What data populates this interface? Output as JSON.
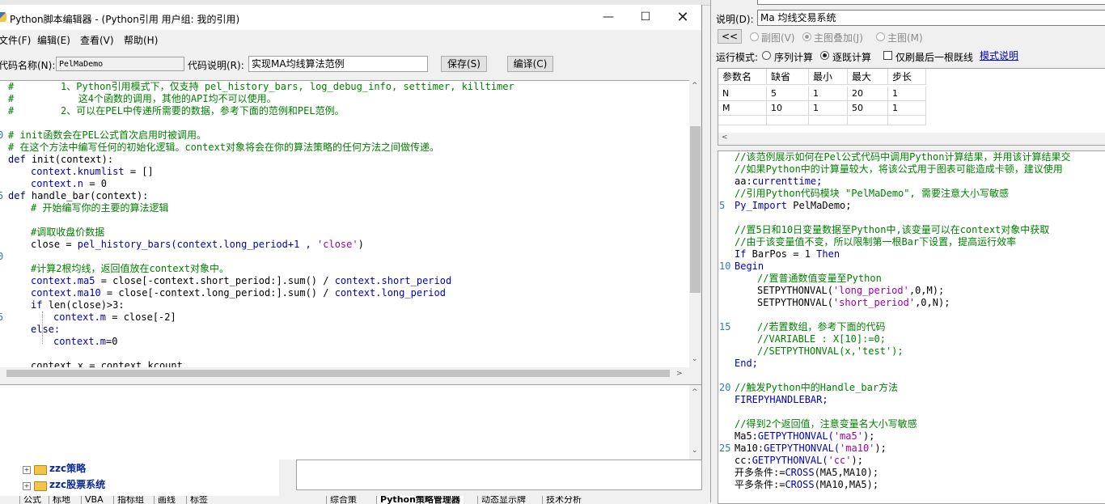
{
  "editor": {
    "title": "Python脚本编辑器 - (Python引用 用户组: 我的引用)",
    "menu": [
      "文件(F)",
      "编辑(E)",
      "查看(V)",
      "帮助(H)"
    ],
    "code_name_label": "代码名称(N):",
    "code_name_value": "PelMaDemo",
    "code_desc_label": "代码说明(R):",
    "code_desc_value": "实现MA均线算法范例",
    "save_label": "保存(S)",
    "compile_label": "编译(C)",
    "line_numbers": {
      "l5": "0",
      "l10": "5",
      "l15": "0",
      "l20": "5"
    },
    "code": {
      "c0": "#        1、Python引用模式下，仅支持 pel_history_bars, log_debug_info, settimer, killtimer",
      "c1": "#           这4个函数的调用，其他的API均不可以使用。",
      "c2": "#        2、可以在PEL中传递所需要的数据，参考下面的范例和PEL范例。",
      "c4a": "# init函数会在PEL公式首次启用时被调用。",
      "c5": "# 在这个方法中编写任何的初始化逻辑。context对象将会在你的算法策略的任何方法之间做传递。",
      "c6a": "def ",
      "c6b": "init(context):",
      "c7a": "context.knumlist",
      "c7b": " = []",
      "c8a": "context.n",
      "c8b": " = 0",
      "c9a": "def ",
      "c9b": "handle_bar(context):",
      "c10": "# 开始编写你的主要的算法逻辑",
      "c12": "#调取收盘价数据",
      "c13a": "close = ",
      "c13b": "pel_history_bars(context.long_period+1 , ",
      "c13c": "'close'",
      "c13d": ")",
      "c15": "#计算2根均线，返回值放在context对象中。",
      "c16a": "context.ma5",
      "c16b": " = close[-context.short_period:].sum() / ",
      "c16c": "context.short_period",
      "c17a": "context.ma10",
      "c17b": " = close[-context.long_period:].sum() / ",
      "c17c": "context.long_period",
      "c18a": "if ",
      "c18b": "len(close)>3:",
      "c19a": "context.m",
      "c19b": " = close[-2]",
      "c20": "else:",
      "c21a": "context.m",
      "c21b": "=0",
      "c23": "context.x = context.kcount"
    }
  },
  "tree": {
    "items": [
      "zzc策略",
      "zzc股票系统"
    ]
  },
  "bottom_tabs_left": [
    "公式",
    "标地",
    "VBA",
    "指标组",
    "画线",
    "标签"
  ],
  "bottom_tabs_right": [
    "综合策",
    "Python策略管理器",
    "动态显示牌",
    "技术分析"
  ],
  "right": {
    "desc_label": "说明(D):",
    "desc_value": "Ma 均线交易系统",
    "back_button": "<<",
    "view_options": [
      "副图(V)",
      "主图叠加(J)",
      "主图(M)"
    ],
    "run_mode_label": "运行模式:",
    "run_modes": [
      "序列计算",
      "逐既计算"
    ],
    "refresh_last_label": "仅刷最后一根既线",
    "template_link": "模式说明",
    "params_headers": [
      "参数名",
      "缺省",
      "最小",
      "最大",
      "步长"
    ],
    "params_rows": [
      [
        "N",
        "5",
        "1",
        "20",
        "1"
      ],
      [
        "M",
        "10",
        "1",
        "50",
        "1"
      ]
    ],
    "pel_line_numbers": {
      "p5": "5",
      "p10": "10",
      "p15": "15",
      "p20": "20",
      "p25": "25"
    },
    "pel": {
      "p0": "//该范例展示如何在Pel公式代码中调用Python计算结果，并用该计算结果交",
      "p1": "//如果Python中的计算量较大，将该公式用于图表可能造成卡顿，建议使用",
      "p2a": "aa:",
      "p2b": "currenttime;",
      "p3": "//引用Python代码模块 \"PelMaDemo\", 需要注意大小写敏感",
      "p4a": "Py_Import",
      "p4b": " PelMaDemo;",
      "p6": "//置5日和10日变量数据至Python中,该变量可以在context对象中获取",
      "p7": "//由于该变量值不变，所以限制第一根Bar下设置，提高运行效率",
      "p8a": "If",
      "p8b": " BarPos = 1 ",
      "p8c": "Then",
      "p9": "Begin",
      "p10": "//置普通数值变量至Python",
      "p11a": "SETPYTHONVAL(",
      "p11b": "'long_period'",
      "p11c": ",0,M);",
      "p12a": "SETPYTHONVAL(",
      "p12b": "'short_period'",
      "p12c": ",0,N);",
      "p14": "//若置数组，参考下面的代码",
      "p15": "//VARIABLE : X[10]:=0;",
      "p16": "//SETPYTHONVAL(x,'test');",
      "p17": "End;",
      "p19": "//触发Python中的Handle_bar方法",
      "p20": "FIREPYHANDLEBAR;",
      "p22": "//得到2个返回值，注意变量名大小写敏感",
      "p23a": "Ma5:",
      "p23b": "GETPYTHONVAL(",
      "p23c": "'ma5'",
      "p23d": ");",
      "p24a": "Ma10:",
      "p24b": "GETPYTHONVAL(",
      "p24c": "'ma10'",
      "p24d": ");",
      "p25a": "cc:",
      "p25b": "GETPYTHONVAL(",
      "p25c": "'cc'",
      "p25d": ");",
      "p26a": "开多条件:=",
      "p26b": "CROSS",
      "p26c": "(MA5,MA10);",
      "p27a": "平多条件:=",
      "p27b": "CROSS",
      "p27c": "(MA10,MA5);"
    }
  },
  "colors": {
    "comment": "#008000",
    "keyword": "#000080",
    "string": "#a000a0",
    "link": "#0000c0"
  }
}
